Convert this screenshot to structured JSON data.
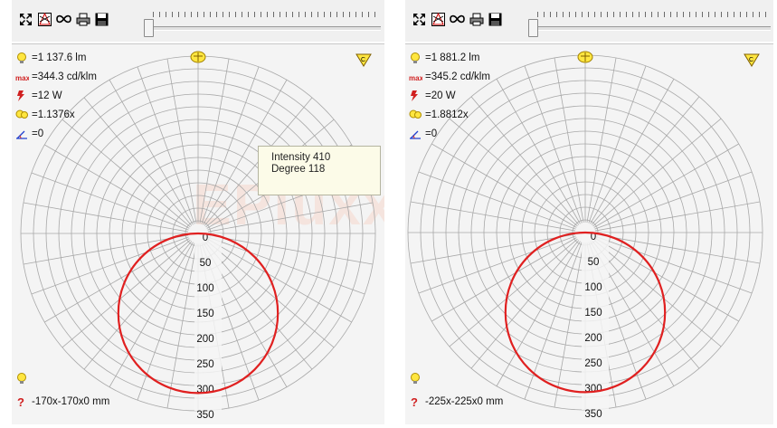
{
  "watermark": "EPluxx",
  "panels": [
    {
      "lumen": "=1 137.6 lm",
      "max_intensity": "=344.3 cd/klm",
      "power": "=12 W",
      "factor": "=1.1376x",
      "tilt": "=0",
      "dimensions": "-170x-170x0 mm",
      "radial_labels": [
        "0",
        "50",
        "100",
        "150",
        "200",
        "250",
        "300",
        "350"
      ],
      "tooltip": {
        "line1": "Intensity 410",
        "line2": "Degree 118"
      },
      "curve_color": "#e02020"
    },
    {
      "lumen": "=1 881.2 lm",
      "max_intensity": "=345.2 cd/klm",
      "power": "=20 W",
      "factor": "=1.8812x",
      "tilt": "=0",
      "dimensions": "-225x-225x0 mm",
      "radial_labels": [
        "0",
        "50",
        "100",
        "150",
        "200",
        "250",
        "300",
        "350"
      ],
      "curve_color": "#e02020"
    }
  ],
  "toolbar_icons": [
    "fit-view-icon",
    "3d-view-icon",
    "polar-curve-icon",
    "print-icon",
    "save-icon"
  ]
}
